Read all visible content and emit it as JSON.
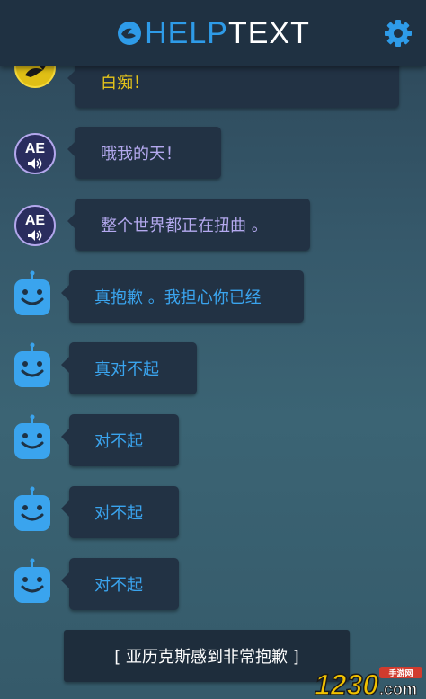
{
  "header": {
    "logo_part1": "HELP",
    "logo_part2": "TEXT"
  },
  "messages": [
    {
      "speaker": "yellow",
      "text": "白痴！"
    },
    {
      "speaker": "AE",
      "text": "哦我的天！"
    },
    {
      "speaker": "AE",
      "text": "整个世界都正在扭曲 。"
    },
    {
      "speaker": "bot",
      "text": "真抱歉 。我担心你已经"
    },
    {
      "speaker": "bot",
      "text": "真对不起"
    },
    {
      "speaker": "bot",
      "text": "对不起"
    },
    {
      "speaker": "bot",
      "text": "对不起"
    },
    {
      "speaker": "bot",
      "text": "对不起"
    }
  ],
  "avatar_labels": {
    "ae": "AE"
  },
  "system_message": "[ 亚历克斯感到非常抱歉 ]",
  "watermark": {
    "main": "1230",
    "suffix": ".com",
    "badge": "手游网"
  },
  "colors": {
    "accent_blue": "#2e9be8",
    "ae_text": "#b4a9ef",
    "bot_text": "#3aa4ee",
    "yellow_text": "#e5c41a"
  }
}
